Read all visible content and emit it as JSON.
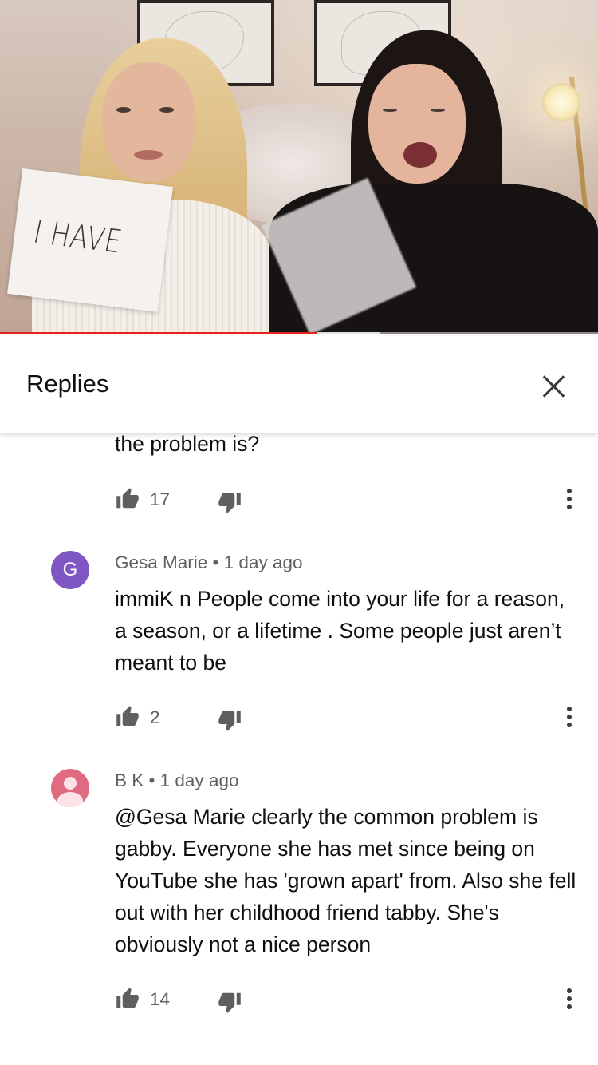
{
  "video": {
    "sign_text": "I HAVE",
    "progress_fraction": 0.53,
    "buffer_fraction": 0.635,
    "progress_color": "#e62117"
  },
  "replies_panel": {
    "title": "Replies",
    "close_icon": "close-icon"
  },
  "comments": [
    {
      "text": "the problem is?",
      "likes": "17"
    },
    {
      "avatar_letter": "G",
      "avatar_color": "#7e57c2",
      "meta": "Gesa Marie • 1 day ago",
      "text": "immiK n People come into your life for a reason, a season, or a lifetime . Some people just aren’t meant to be",
      "likes": "2"
    },
    {
      "avatar_icon": "default-user-avatar-icon",
      "avatar_color": "#e06a7f",
      "meta": "B K • 1 day ago",
      "text": "@Gesa Marie clearly the common problem is gabby. Everyone she has met since being on YouTube she has 'grown apart' from. Also she fell out with her childhood friend tabby. She's obviously not a nice person",
      "likes": "14"
    }
  ]
}
